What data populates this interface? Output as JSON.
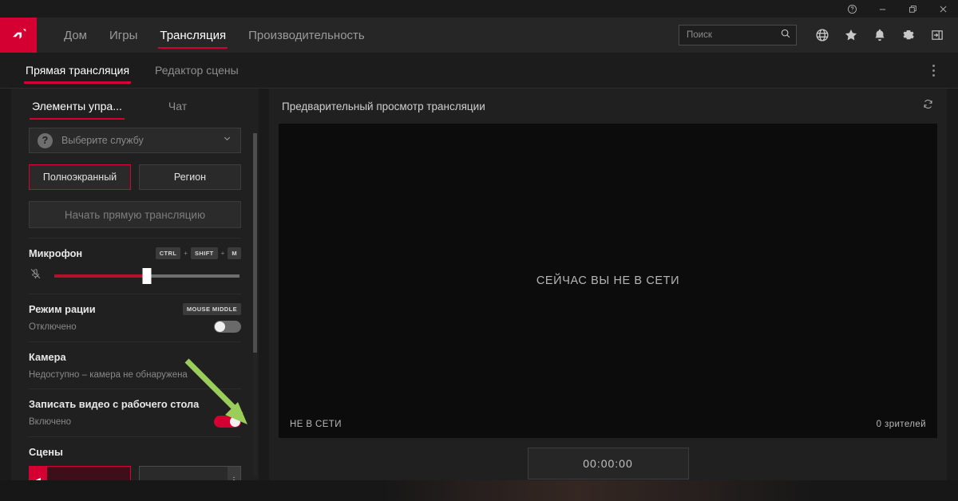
{
  "window": {
    "controls": [
      {
        "name": "help",
        "glyph": "?"
      },
      {
        "name": "minimize",
        "glyph": "—"
      },
      {
        "name": "restore",
        "glyph": "❐"
      },
      {
        "name": "close",
        "glyph": "✕"
      }
    ]
  },
  "navbar": {
    "logo_alt": "AMD",
    "items": [
      {
        "label": "Дом",
        "active": false
      },
      {
        "label": "Игры",
        "active": false
      },
      {
        "label": "Трансляция",
        "active": true
      },
      {
        "label": "Производительность",
        "active": false
      }
    ],
    "search": {
      "placeholder": "Поиск",
      "value": ""
    },
    "icons": [
      "globe-icon",
      "star-icon",
      "bell-icon",
      "gear-icon",
      "panel-icon"
    ]
  },
  "subnav": {
    "tabs": [
      {
        "label": "Прямая трансляция",
        "active": true
      },
      {
        "label": "Редактор сцены",
        "active": false
      }
    ],
    "overflow": "kebab-menu"
  },
  "left_panel": {
    "tabs": [
      {
        "label": "Элементы упра...",
        "active": true
      },
      {
        "label": "Чат",
        "active": false
      }
    ],
    "service": {
      "placeholder": "Выберите службу",
      "value": ""
    },
    "capture_modes": [
      {
        "label": "Полноэкранный",
        "selected": true
      },
      {
        "label": "Регион",
        "selected": false
      }
    ],
    "start_button": "Начать прямую трансляцию",
    "microphone": {
      "title": "Микрофон",
      "hotkeys": [
        "CTRL",
        "SHIFT",
        "M"
      ],
      "muted": true,
      "level_percent": 50
    },
    "push_to_talk": {
      "title": "Режим рации",
      "hotkey": "MOUSE MIDDLE",
      "status": "Отключено",
      "enabled": false
    },
    "camera": {
      "title": "Камера",
      "status": "Недоступно – камера не обнаружена"
    },
    "desktop_recording": {
      "title": "Записать видео с рабочего стола",
      "status": "Включено",
      "enabled": true
    },
    "scenes": {
      "title": "Сцены"
    }
  },
  "preview": {
    "title": "Предварительный просмотр трансляции",
    "refresh_icon": "refresh-icon",
    "offline_message": "СЕЙЧАС ВЫ НЕ В СЕТИ",
    "status_left": "НЕ В СЕТИ",
    "status_right": "0 зрителей",
    "timer": "00:00:00"
  },
  "colors": {
    "accent": "#d50032",
    "panel": "#202020",
    "background": "#1a1a1a",
    "annotation_arrow": "#9acd5a"
  }
}
